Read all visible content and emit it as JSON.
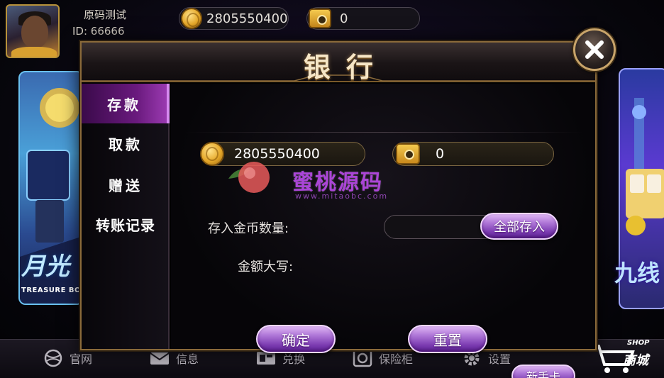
{
  "player": {
    "name": "原码测试",
    "id_text": "ID: 66666"
  },
  "top_balances": {
    "gold": "2805550400",
    "bank": "0"
  },
  "lobby": {
    "left_card_title": "月光",
    "left_card_sub": "TREASURE BOX",
    "right_card_title": "九线",
    "nav": {
      "official": "官网",
      "messages": "信息",
      "exchange": "兑换",
      "safe": "保险柜",
      "settings": "设置",
      "shop": "商城",
      "shop_en": "SHOP"
    }
  },
  "dialog": {
    "title": "银行",
    "tabs": [
      {
        "label": "存款",
        "active": true
      },
      {
        "label": "取款",
        "active": false
      },
      {
        "label": "赠送",
        "active": false
      },
      {
        "label": "转账记录",
        "active": false
      }
    ],
    "balances": {
      "gold": "2805550400",
      "bank": "0"
    },
    "deposit_label": "存入金币数量:",
    "amount_value": "",
    "amount_words_label": "金额大写:",
    "buttons": {
      "deposit_all": "全部存入",
      "confirm": "确定",
      "reset": "重置",
      "newbie_card": "新手卡"
    }
  },
  "watermark": {
    "text": "蜜桃源码",
    "url": "www.mitaobc.com"
  },
  "colors": {
    "accent_purple": "#9a3ab0",
    "gold_border": "#8a6a3a",
    "title_text": "#f6e6c6"
  },
  "icons": [
    "coin-icon",
    "safe-icon",
    "close-icon",
    "globe-icon",
    "mail-icon",
    "exchange-icon",
    "vault-icon",
    "gear-icon",
    "cart-icon"
  ]
}
